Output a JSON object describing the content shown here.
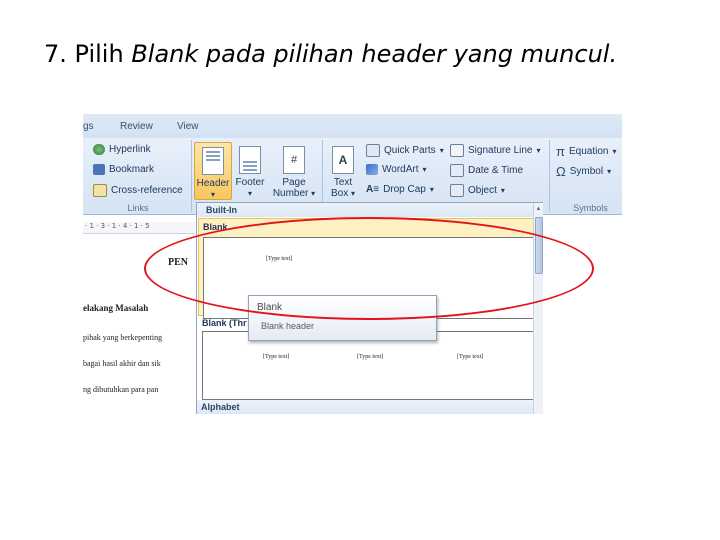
{
  "slide": {
    "title_prefix": "7. Pilih ",
    "title_em": "Blank pada pilihan header yang muncul."
  },
  "ribbon": {
    "tabs": [
      "gs",
      "Review",
      "View"
    ],
    "links_group": {
      "label": "Links",
      "items": [
        "Hyperlink",
        "Bookmark",
        "Cross-reference"
      ]
    },
    "header_footer": {
      "header": "Header",
      "footer": "Footer",
      "page_number_1": "Page",
      "page_number_2": "Number"
    },
    "text_group": {
      "text_box_1": "Text",
      "text_box_2": "Box",
      "quick_parts": "Quick Parts",
      "wordart": "WordArt",
      "drop_cap": "Drop Cap",
      "signature_line": "Signature Line",
      "date_time": "Date & Time",
      "object": "Object"
    },
    "symbols_group": {
      "label": "Symbols",
      "equation": "Equation",
      "symbol": "Symbol"
    }
  },
  "document": {
    "ruler": "· 1 · 3 · 1 · 4 · 1 · 5",
    "heading": "PEN",
    "subheading": "elakang Masalah",
    "lines": [
      "pihak yang berkepenting",
      "bagai hasil akhir dan sik",
      "ng dibutuhkan para pan"
    ]
  },
  "gallery": {
    "section_builtin": "Built-In",
    "item_blank": "Blank",
    "placeholder": "[Type text]",
    "item_blank_three": "Blank (Thr",
    "section_alphabet": "Alphabet"
  },
  "tooltip": {
    "title": "Blank",
    "description": "Blank header"
  },
  "colors": {
    "highlight_circle": "#e2131b",
    "selected_item": "#fdf0c2",
    "ribbon_bg": "#d5e3f3"
  }
}
